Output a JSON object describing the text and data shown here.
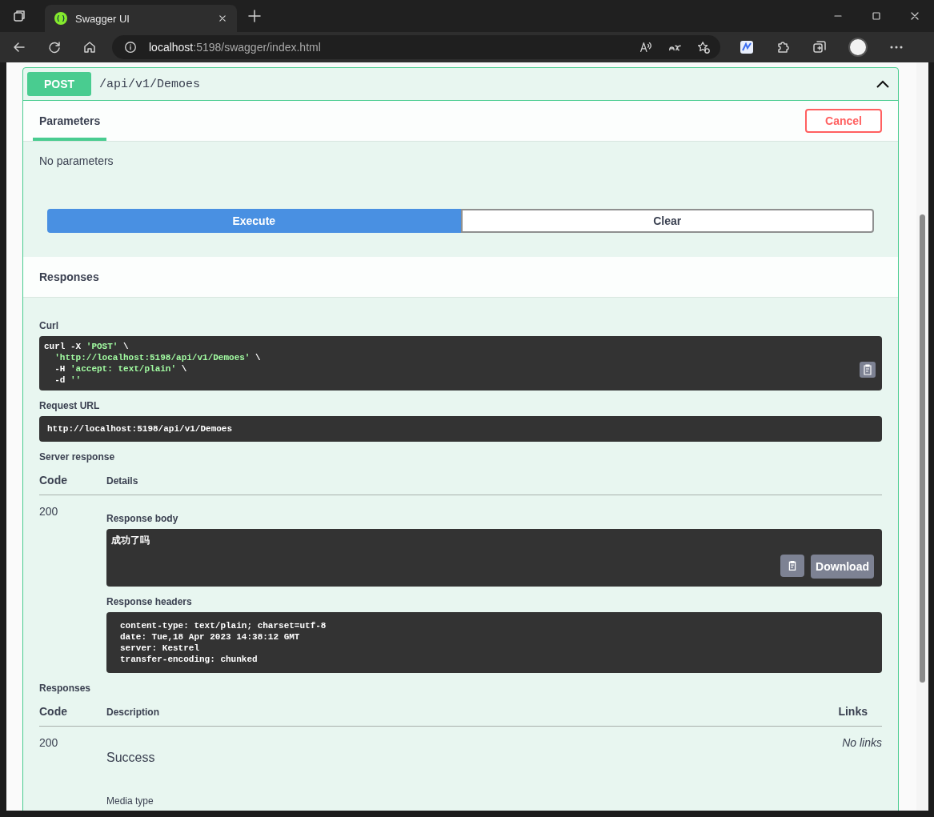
{
  "browser": {
    "tab_title": "Swagger UI",
    "url_host": "localhost",
    "url_path": ":5198/swagger/index.html"
  },
  "operation": {
    "method": "POST",
    "path": "/api/v1/Demoes",
    "expanded": true
  },
  "tabs": [
    {
      "label": "Parameters",
      "selected": true
    }
  ],
  "cancel_button": "Cancel",
  "parameters_note": "No parameters",
  "buttons": [
    {
      "label": "Execute",
      "kind": "primary"
    },
    {
      "label": "Clear",
      "kind": "secondary"
    }
  ],
  "responses_title": "Responses",
  "curl": {
    "label": "Curl",
    "lines": [
      [
        {
          "text": "curl -X ",
          "kind": "plain"
        },
        {
          "text": "'POST'",
          "kind": "string"
        },
        {
          "text": " \\",
          "kind": "plain"
        }
      ],
      [
        {
          "text": "'http://localhost:5198/api/v1/Demoes'",
          "kind": "string"
        },
        {
          "text": " \\",
          "kind": "plain"
        }
      ],
      [
        {
          "text": "-H ",
          "kind": "plain"
        },
        {
          "text": "'accept: text/plain'",
          "kind": "string"
        },
        {
          "text": " \\",
          "kind": "plain"
        }
      ],
      [
        {
          "text": "-d ",
          "kind": "plain"
        },
        {
          "text": "''",
          "kind": "string"
        }
      ]
    ]
  },
  "request_url": {
    "label": "Request URL",
    "value": "http://localhost:5198/api/v1/Demoes"
  },
  "server_response": {
    "label": "Server response",
    "columns": [
      "Code",
      "Details"
    ],
    "code": "200",
    "body_label": "Response body",
    "body": "成功了吗",
    "download_button": "Download",
    "headers_label": "Response headers",
    "headers": [
      "content-type: text/plain; charset=utf-8",
      "date: Tue,18 Apr 2023 14:38:12 GMT",
      "server: Kestrel",
      "transfer-encoding: chunked"
    ]
  },
  "responses": {
    "label": "Responses",
    "columns": [
      "Code",
      "Description",
      "Links"
    ],
    "rows": [
      {
        "code": "200",
        "description": "Success",
        "links": "No links",
        "media_type_label": "Media type"
      }
    ]
  }
}
